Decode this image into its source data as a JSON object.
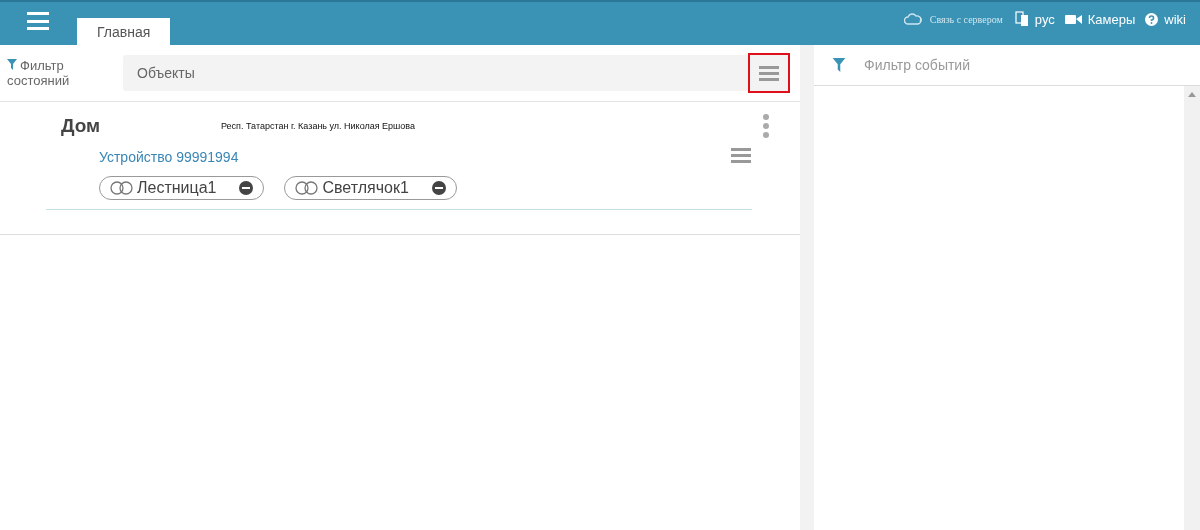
{
  "topbar": {
    "tabs": [
      {
        "label": "Главная",
        "selected": true
      }
    ],
    "server_status": "Связь с сервером",
    "language": "рус",
    "cameras": "Камеры",
    "help": "wiki"
  },
  "left": {
    "state_filter": "Фильтр состояний",
    "objects_field": {
      "placeholder": "Объекты"
    },
    "menu_highlighted": true,
    "objects": [
      {
        "name": "Дом",
        "address": "Респ. Татарстан г. Казань ул. Николая Ершова",
        "devices": [
          {
            "name": "Устройство 99991994",
            "sensors": [
              {
                "name": "Лестница1"
              },
              {
                "name": "Светлячок1"
              }
            ]
          }
        ]
      }
    ]
  },
  "right": {
    "events_field": {
      "placeholder": "Фильтр событий"
    }
  }
}
